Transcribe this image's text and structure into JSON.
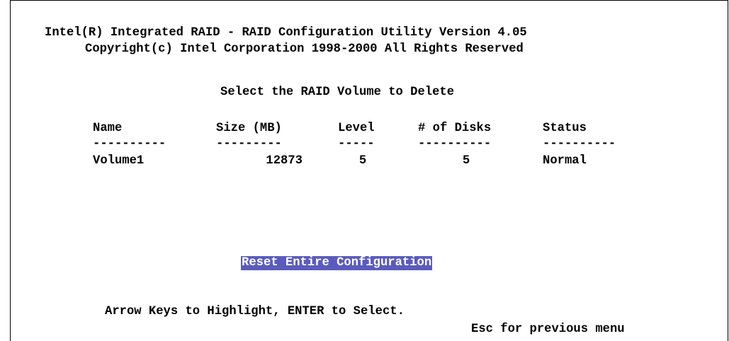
{
  "header": {
    "title": "Intel(R) Integrated RAID - RAID Configuration Utility Version 4.05",
    "copyright": "Copyright(c) Intel Corporation 1998-2000 All Rights Reserved"
  },
  "prompt": "Select the RAID Volume to Delete",
  "table": {
    "columns": [
      "Name",
      "Size (MB)",
      "Level",
      "# of Disks",
      "Status"
    ],
    "dashes": [
      "----------",
      "---------",
      "-----",
      "----------",
      "----------"
    ],
    "rows": [
      {
        "name": "Volume1",
        "size": "12873",
        "level": "5",
        "disks": "5",
        "status": "Normal"
      }
    ]
  },
  "menu": {
    "reset_label": "Reset Entire Configuration"
  },
  "footer": {
    "instructions": "Arrow Keys to Highlight, ENTER to Select.",
    "escape": "Esc for previous menu"
  },
  "colors": {
    "highlight_bg": "#5b5bbd",
    "highlight_fg": "#ffffff"
  }
}
